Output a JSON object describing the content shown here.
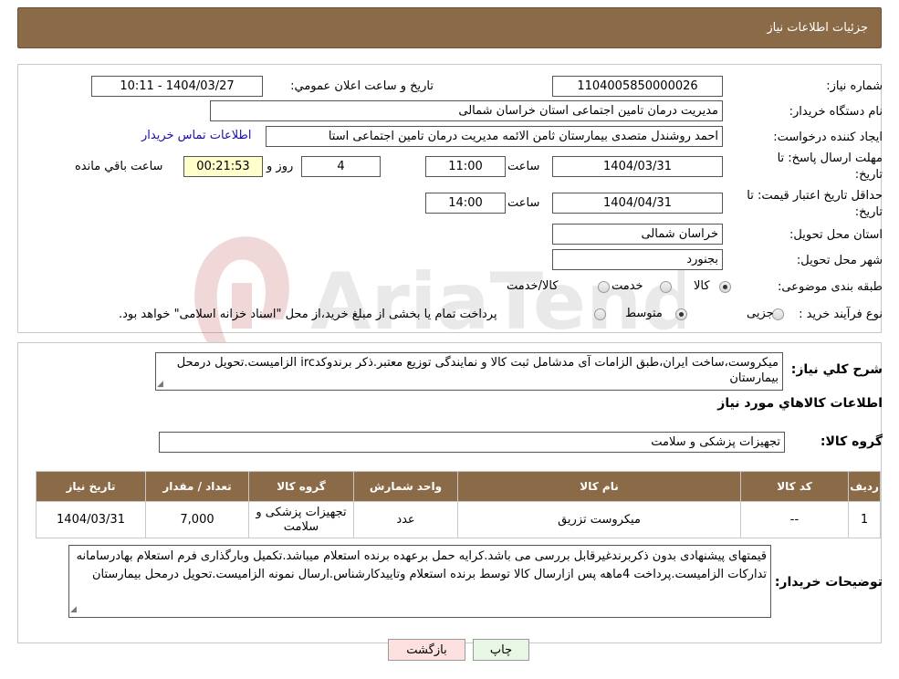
{
  "header": {
    "title": "جزئیات اطلاعات نیاز"
  },
  "form": {
    "need_number_label": "شماره نیاز:",
    "need_number": "1104005850000026",
    "announce_label": "تاريخ و ساعت اعلان عمومي:",
    "announce_value": "1404/03/27 - 10:11",
    "buyer_org_label": "نام دستگاه خریدار:",
    "buyer_org": "مدیریت درمان تامین اجتماعی استان خراسان شمالی",
    "creator_label": "ایجاد کننده درخواست:",
    "creator": "احمد روشندل متصدی بیمارستان ثامن الائمه مدیریت درمان تامین اجتماعی استا",
    "contact_link": "اطلاعات تماس خریدار",
    "deadline_label_1": "مهلت ارسال پاسخ: تا",
    "deadline_label_2": "تاریخ:",
    "deadline_date": "1404/03/31",
    "time_label": "ساعت",
    "deadline_time": "11:00",
    "days_value": "4",
    "days_label": "روز و",
    "remaining_value": "00:21:53",
    "remaining_label": "ساعت باقي مانده",
    "validity_label_1": "حداقل تاریخ اعتبار قیمت: تا",
    "validity_label_2": "تاریخ:",
    "validity_date": "1404/04/31",
    "validity_time": "14:00",
    "province_label": "استان محل تحویل:",
    "province": "خراسان شمالی",
    "city_label": "شهر محل تحویل:",
    "city": "بجنورد",
    "category_label": "طبقه بندی موضوعی:",
    "category_options": [
      "کالا",
      "خدمت",
      "کالا/خدمت"
    ],
    "process_label": "نوع فرآیند خرید :",
    "process_options": [
      "جزیی",
      "متوسط"
    ],
    "process_note": "پرداخت تمام یا بخشی از مبلغ خرید،از محل \"اسناد خزانه اسلامی\" خواهد بود."
  },
  "summary": {
    "label": "شرح کلي نياز:",
    "text": "میکروست،ساخت ایران،طبق الزامات آی مدشامل ثبت کالا و نمایندگی توزیع معتبر.ذکر برندوکدirc الزامیست.تحویل درمحل بیمارستان"
  },
  "goods": {
    "title": "اطلاعات کالاهاي مورد نياز",
    "group_label": "گروه کالا:",
    "group_value": "تجهیزات پزشکی و سلامت"
  },
  "table": {
    "headers": [
      "رديف",
      "کد کالا",
      "نام کالا",
      "واحد شمارش",
      "گروه کالا",
      "تعداد / مقدار",
      "تاريخ نياز"
    ],
    "rows": [
      [
        "1",
        "--",
        "میکروست تزریق",
        "عدد",
        "تجهیزات پزشکی و سلامت",
        "7,000",
        "1404/03/31"
      ]
    ]
  },
  "buyer_notes": {
    "label": "توضیحات خریدار:",
    "text": "قیمتهای پیشنهادی بدون ذکربرندغیرقابل بررسی می باشد.کرایه حمل برعهده برنده استعلام میباشد.تکمیل وبارگذاری فرم استعلام بهادرسامانه تدارکات الزامیست.پرداخت 4ماهه پس ازارسال کالا توسط برنده استعلام وتاییدکارشناس.ارسال نمونه الزامیست.تحویل درمحل بیمارستان"
  },
  "buttons": {
    "print": "چاپ",
    "back": "بازگشت"
  },
  "colors": {
    "header": "#8b6a47",
    "back_button": "#fde0e0",
    "print_button": "#e8f7e4"
  }
}
